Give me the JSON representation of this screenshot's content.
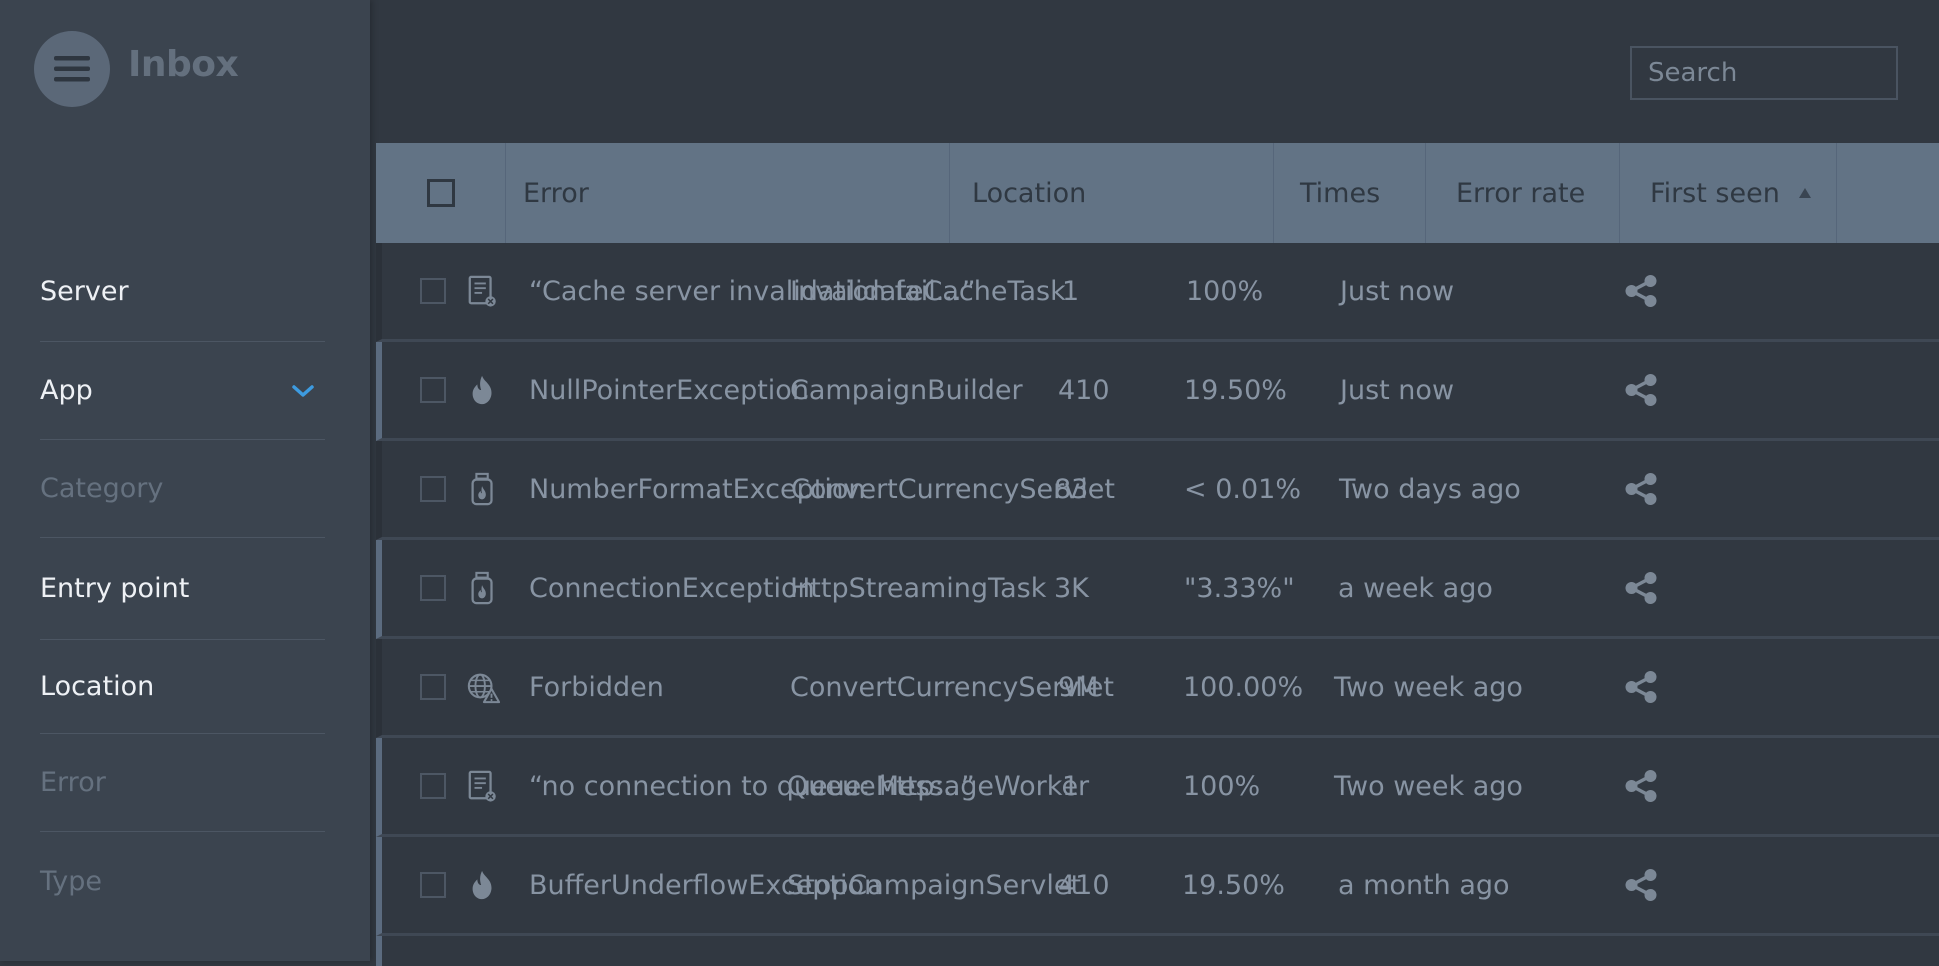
{
  "app": {
    "title": "Inbox"
  },
  "search": {
    "placeholder": "Search"
  },
  "sidebar": {
    "items": [
      {
        "label": "Server",
        "state": "active"
      },
      {
        "label": "App",
        "state": "active",
        "expanded": true
      },
      {
        "label": "Category",
        "state": "muted"
      },
      {
        "label": "Entry point",
        "state": "active"
      },
      {
        "label": "Location",
        "state": "active"
      },
      {
        "label": "Error",
        "state": "muted"
      },
      {
        "label": "Type",
        "state": "muted"
      }
    ]
  },
  "table": {
    "headers": {
      "error": "Error",
      "location": "Location",
      "times": "Times",
      "error_rate": "Error rate",
      "first_seen": "First seen"
    },
    "sort": {
      "column": "First seen",
      "direction": "ascending"
    },
    "rows": [
      {
        "icon": "document-error-icon",
        "error": "“Cache server invalidation fail...”",
        "location": "InvalidateCacheTask",
        "times": "1",
        "rate": "100%",
        "first_seen": "Just now"
      },
      {
        "icon": "flame-icon",
        "error": "NullPointerException",
        "location": "CampaignBuilder",
        "times": "410",
        "rate": "19.50%",
        "first_seen": "Just now"
      },
      {
        "icon": "jar-icon",
        "error": "NumberFormatException",
        "location": "ConvertCurrencyServlet",
        "times": "83",
        "rate": "< 0.01%",
        "first_seen": "Two days ago"
      },
      {
        "icon": "jar-icon",
        "error": "ConnectionException",
        "location": "HttpStreamingTask",
        "times": "3K",
        "rate": "\"3.33%\"",
        "first_seen": "a week ago"
      },
      {
        "icon": "globe-warning-icon",
        "error": "Forbidden",
        "location": "ConvertCurrencyServlet",
        "times": "9M",
        "rate": "100.00%",
        "first_seen": "Two week ago"
      },
      {
        "icon": "document-error-icon",
        "error": "“no connection to queue: http:..”",
        "location": "QueueMessageWorker",
        "times": "1",
        "rate": "100%",
        "first_seen": "Two week ago"
      },
      {
        "icon": "flame-icon",
        "error": "BufferUnderflowException",
        "location": "StopCampaignServlet",
        "times": "410",
        "rate": "19.50%",
        "first_seen": "a month ago"
      }
    ]
  },
  "colors": {
    "background": "#313841",
    "sidebar": "#3b444f",
    "header": "#627385",
    "accent": "#3d9be0"
  }
}
